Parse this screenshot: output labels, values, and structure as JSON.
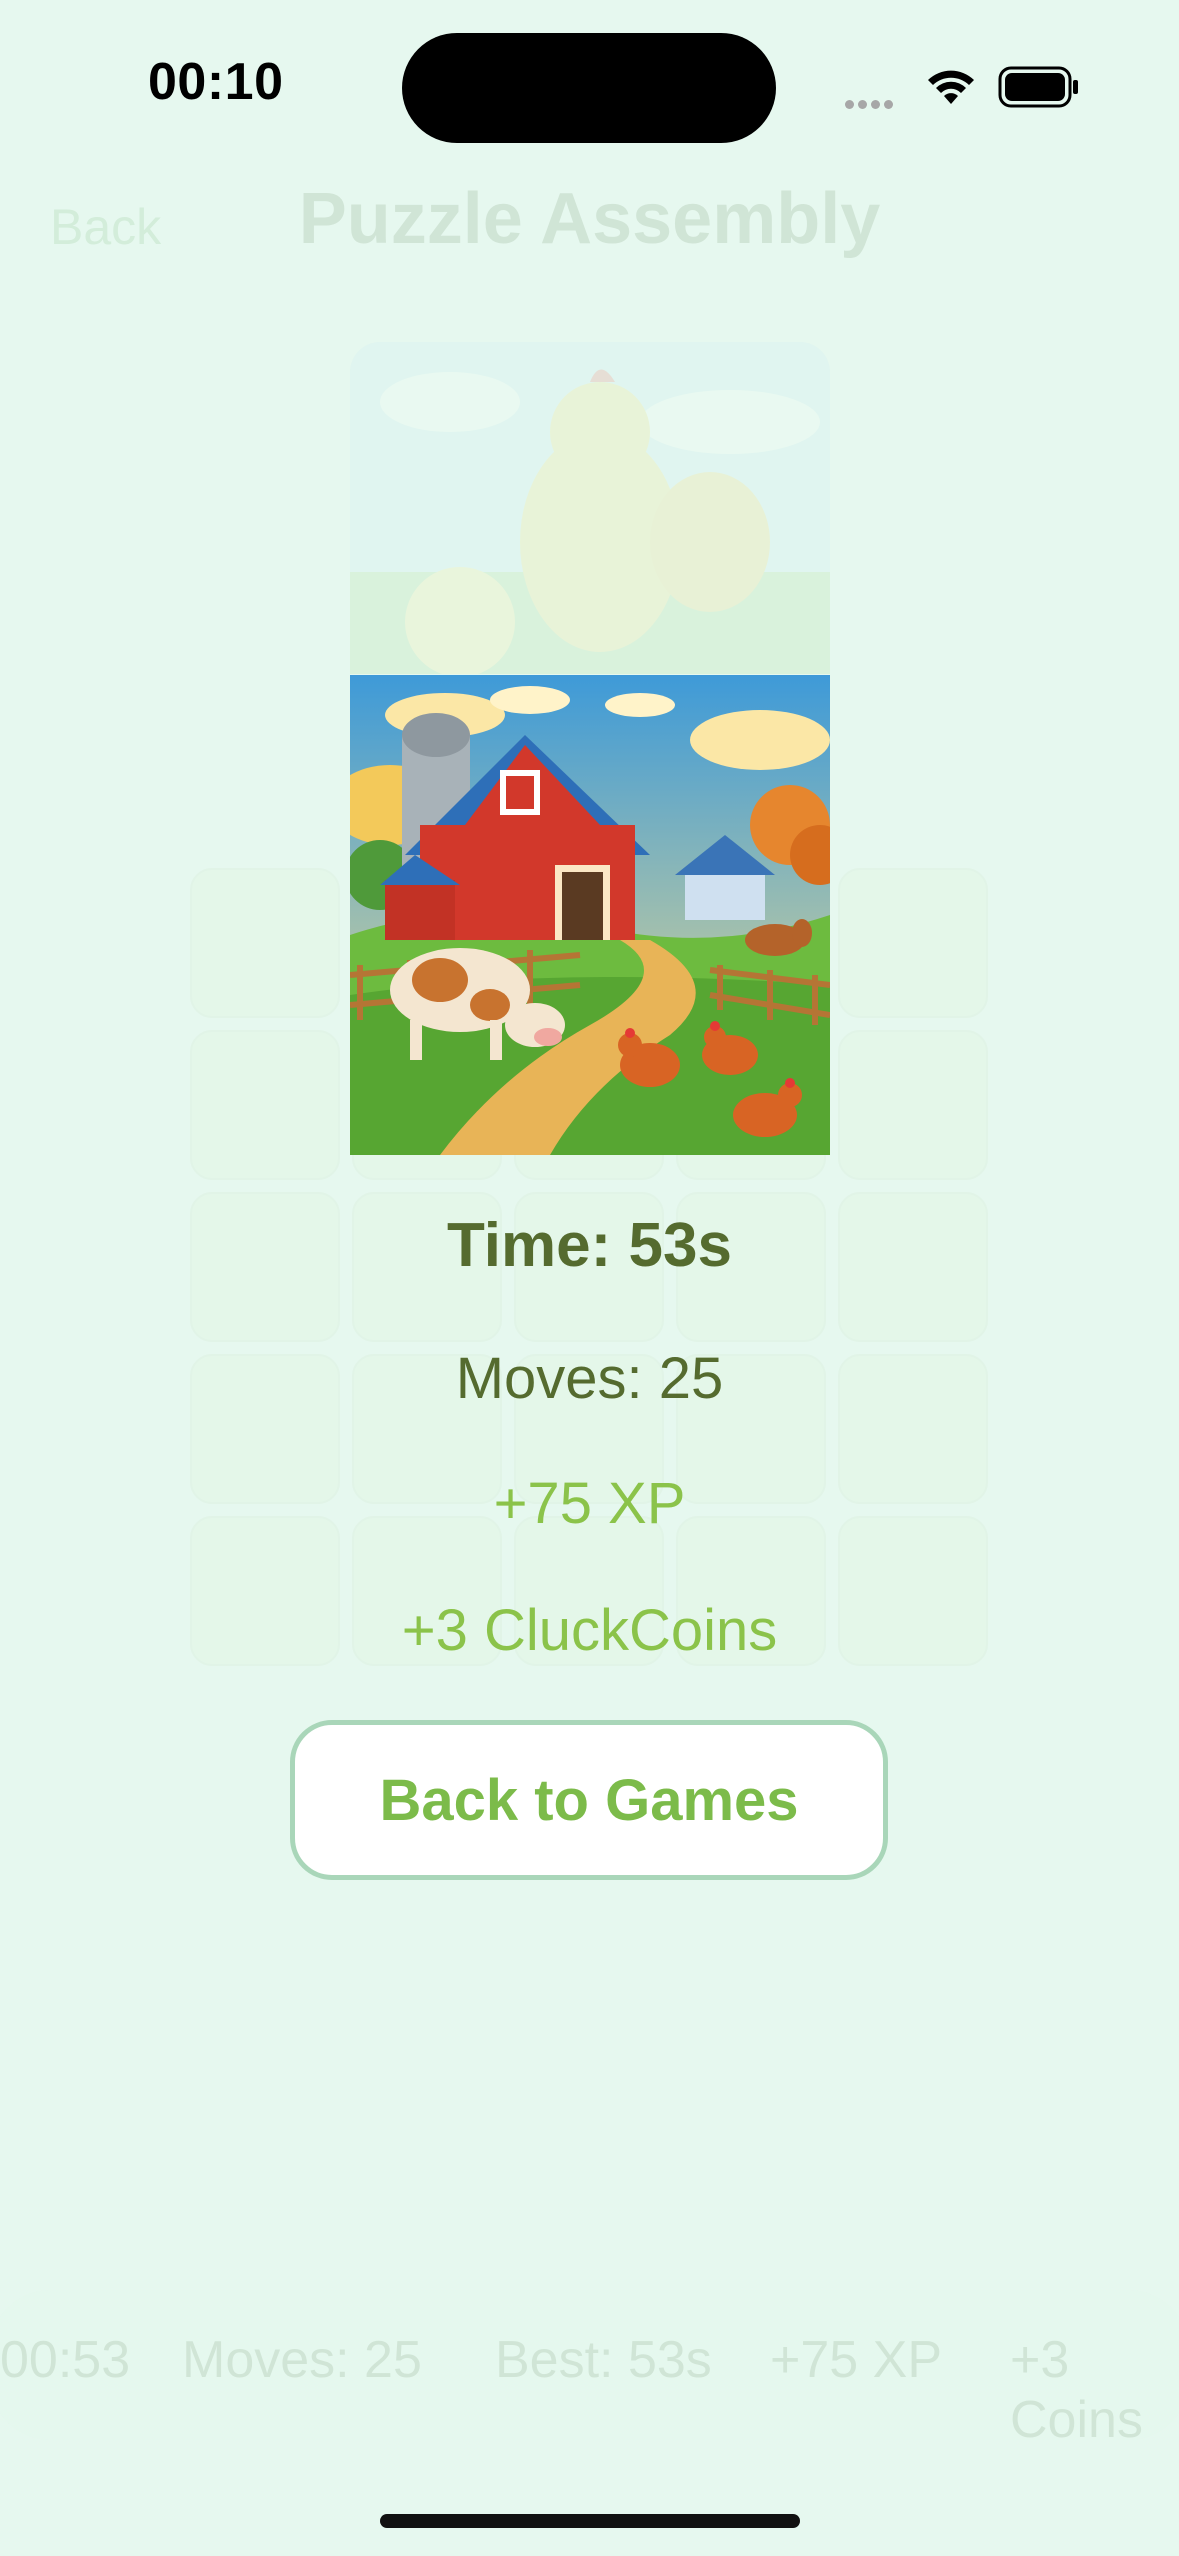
{
  "status_bar": {
    "time": "00:10"
  },
  "background_screen": {
    "back_label": "Back",
    "title": "Puzzle Assembly",
    "bottom_bar": {
      "timer": "00:53",
      "moves": "Moves: 25",
      "best": "Best: 53s",
      "xp": "+75 XP",
      "coins": "+3 Coins"
    }
  },
  "result": {
    "time_text": "Time: 53s",
    "moves_text": "Moves: 25",
    "xp_reward": "+75 XP",
    "coins_reward": "+3 CluckCoins",
    "back_button_label": "Back to Games"
  },
  "colors": {
    "accent_green": "#8bc34a",
    "text_olive": "#556b2f",
    "background": "#e6f8ef",
    "button_border": "#a9d6b9"
  },
  "icons": [
    "wifi-icon",
    "battery-icon",
    "signal-dots-icon"
  ]
}
